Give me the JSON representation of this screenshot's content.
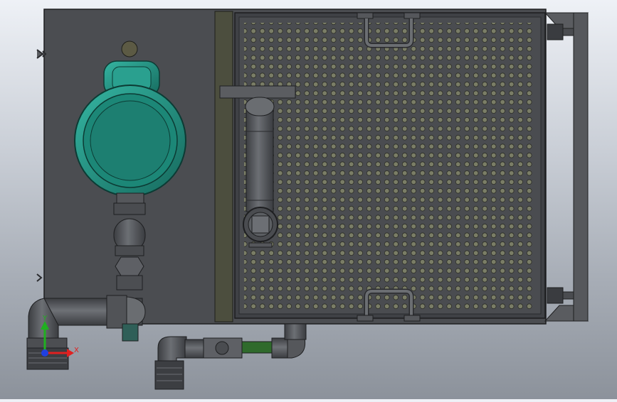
{
  "view": {
    "type": "cad-3d-viewport",
    "background_top": "#eef1f6",
    "background_bottom": "#8c929b"
  },
  "model": {
    "tank_color": "#4b4d51",
    "grill_color": "#4a4c50",
    "frame_strip_color": "#4c4e3e",
    "pump_color": "#1f8a7a",
    "pipe_color": "#55575b",
    "valve_handle_color": "#2f6a2c",
    "hole_color": "#7a7d66"
  },
  "triad": {
    "x_label": "X",
    "y_label": "Y",
    "x_color": "#e02020",
    "y_color": "#20b020",
    "z_color": "#2040e0"
  }
}
